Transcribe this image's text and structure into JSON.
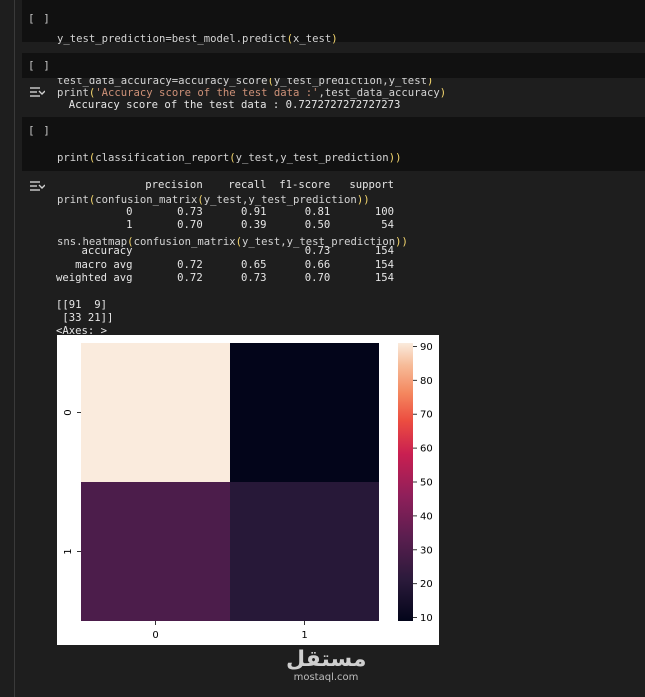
{
  "cells": [
    {
      "run_label": "[ ]",
      "code_lines": [
        "y_test_prediction=best_model.predict(x_test)",
        "test_data_accuracy=accuracy_score(y_test_prediction,y_test)"
      ]
    },
    {
      "run_label": "[ ]",
      "code_lines": [
        "print('Accuracy score of the test data :',test_data_accuracy)"
      ],
      "output_lines": [
        "Accuracy score of the test data : 0.7272727272727273"
      ]
    },
    {
      "run_label": "[ ]",
      "code_lines": [
        "print(classification_report(y_test,y_test_prediction))",
        "print(confusion_matrix(y_test,y_test_prediction))",
        "sns.heatmap(confusion_matrix(y_test,y_test_prediction))"
      ],
      "output_lines": [
        "              precision    recall  f1-score   support",
        "",
        "           0       0.73      0.91      0.81       100",
        "           1       0.70      0.39      0.50        54",
        "",
        "    accuracy                           0.73       154",
        "   macro avg       0.72      0.65      0.66       154",
        "weighted avg       0.72      0.73      0.70       154",
        "",
        "[[91  9]",
        " [33 21]]",
        "<Axes: >"
      ]
    }
  ],
  "chart_data": {
    "type": "heatmap",
    "x_tick_labels": [
      "0",
      "1"
    ],
    "y_tick_labels": [
      "0",
      "1"
    ],
    "values": [
      [
        91,
        9
      ],
      [
        33,
        21
      ]
    ],
    "colorbar_ticks": [
      "90",
      "80",
      "70",
      "60",
      "50",
      "40",
      "30",
      "20",
      "10"
    ],
    "colorbar_range": [
      9,
      91
    ],
    "colormap": "rocket",
    "colors": {
      "cell_0_0": "#faebdd",
      "cell_0_1": "#03051a",
      "cell_1_0": "#4c1d4b",
      "cell_1_1": "#271838"
    }
  },
  "watermark": {
    "arabic": "مستقل",
    "domain": "mostaql.com"
  }
}
